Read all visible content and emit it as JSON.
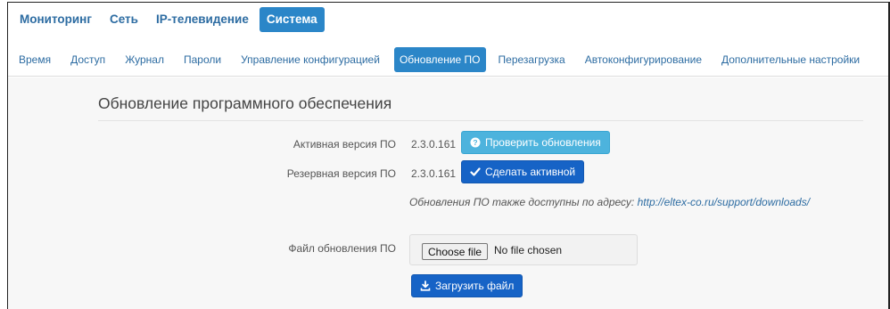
{
  "topnav": {
    "items": [
      {
        "label": "Мониторинг"
      },
      {
        "label": "Сеть"
      },
      {
        "label": "IP-телевидение"
      },
      {
        "label": "Система"
      }
    ]
  },
  "subnav": {
    "items": [
      {
        "label": "Время"
      },
      {
        "label": "Доступ"
      },
      {
        "label": "Журнал"
      },
      {
        "label": "Пароли"
      },
      {
        "label": "Управление конфигурацией"
      },
      {
        "label": "Обновление ПО"
      },
      {
        "label": "Перезагрузка"
      },
      {
        "label": "Автоконфигурирование"
      },
      {
        "label": "Дополнительные настройки"
      }
    ]
  },
  "page": {
    "title": "Обновление программного обеспечения"
  },
  "active_version": {
    "label": "Активная версия ПО",
    "value": "2.3.0.161",
    "button": "Проверить обновления"
  },
  "backup_version": {
    "label": "Резервная версия ПО",
    "value": "2.3.0.161",
    "button": "Сделать активной"
  },
  "hint": {
    "text": "Обновления ПО также доступны по адресу:",
    "link": "http://eltex-co.ru/support/downloads/"
  },
  "upload": {
    "label": "Файл обновления ПО",
    "choose_label": "Choose file",
    "status": "No file chosen",
    "button": "Загрузить файл"
  },
  "colors": {
    "link": "#2d6ca2",
    "active_tab": "#2b86c8",
    "btn_info": "#4db3dd",
    "btn_primary": "#1663c6"
  },
  "icons": {
    "check_updates": "question-circle-icon",
    "make_active": "checkmark-icon",
    "upload": "download-icon"
  }
}
